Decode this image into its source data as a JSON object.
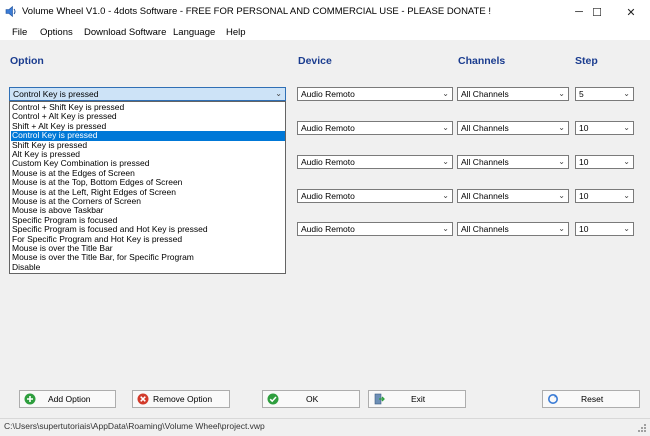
{
  "window": {
    "title": "Volume Wheel V1.0 - 4dots Software - FREE FOR PERSONAL AND COMMERCIAL USE - PLEASE DONATE !",
    "minimize_glyph": "─",
    "maximize_glyph": "☐",
    "close_glyph": "✕"
  },
  "menu": [
    "File",
    "Options",
    "Download Software",
    "Language",
    "Help"
  ],
  "headers": {
    "option": "Option",
    "device": "Device",
    "channels": "Channels",
    "step": "Step"
  },
  "option_combo": {
    "value": "Control Key is pressed"
  },
  "option_list": [
    "Control + Shift Key is pressed",
    "Control + Alt Key is pressed",
    "Shift + Alt Key is pressed",
    "Control Key is pressed",
    "Shift Key is pressed",
    "Alt Key is pressed",
    "Custom Key Combination is pressed",
    "Mouse is at the Edges of Screen",
    "Mouse is at the Top, Bottom Edges of Screen",
    "Mouse is at the Left, Right Edges of Screen",
    "Mouse is at the Corners of Screen",
    "Mouse is above Taskbar",
    "Specific Program is focused",
    "Specific Program is focused and Hot Key is pressed",
    "For Specific Program and Hot Key is pressed",
    "Mouse is over the Title Bar",
    "Mouse is over the Title Bar, for Specific Program",
    "Disable"
  ],
  "selected_option_index": 3,
  "rows": [
    {
      "device": "Audio Remoto",
      "channels": "All Channels",
      "step": "5"
    },
    {
      "device": "Audio Remoto",
      "channels": "All Channels",
      "step": "10"
    },
    {
      "device": "Audio Remoto",
      "channels": "All Channels",
      "step": "10"
    },
    {
      "device": "Audio Remoto",
      "channels": "All Channels",
      "step": "10"
    },
    {
      "device": "Audio Remoto",
      "channels": "All Channels",
      "step": "10"
    }
  ],
  "buttons": {
    "add": "Add Option",
    "remove": "Remove Option",
    "ok": "OK",
    "exit": "Exit",
    "reset": "Reset"
  },
  "status": "C:\\Users\\supertutoriais\\AppData\\Roaming\\Volume Wheel\\project.vwp",
  "colors": {
    "accent": "#0078d7",
    "header_text": "#1a3c8f"
  }
}
